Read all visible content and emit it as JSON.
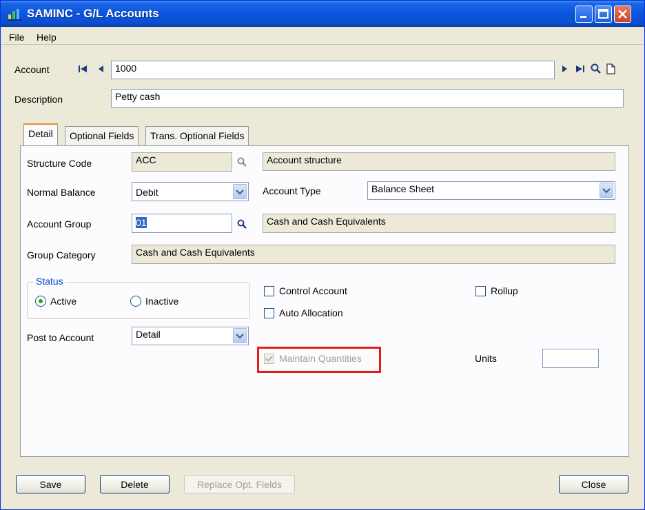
{
  "window": {
    "title": "SAMINC - G/L Accounts"
  },
  "menu": {
    "file": "File",
    "help": "Help"
  },
  "header": {
    "account_label": "Account",
    "account_value": "1000",
    "description_label": "Description",
    "description_value": "Petty cash"
  },
  "tabs": [
    {
      "label": "Detail"
    },
    {
      "label": "Optional Fields"
    },
    {
      "label": "Trans. Optional Fields"
    }
  ],
  "detail": {
    "structure_code_label": "Structure Code",
    "structure_code_value": "ACC",
    "structure_desc": "Account structure",
    "normal_balance_label": "Normal Balance",
    "normal_balance_value": "Debit",
    "account_type_label": "Account Type",
    "account_type_value": "Balance Sheet",
    "account_group_label": "Account Group",
    "account_group_value": "01",
    "account_group_desc": "Cash and Cash Equivalents",
    "group_category_label": "Group Category",
    "group_category_value": "Cash and Cash Equivalents",
    "status_title": "Status",
    "status_active": "Active",
    "status_inactive": "Inactive",
    "control_account": "Control Account",
    "auto_allocation": "Auto Allocation",
    "rollup": "Rollup",
    "post_to_account_label": "Post to Account",
    "post_to_account_value": "Detail",
    "maintain_quantities": "Maintain Quantities",
    "units_label": "Units",
    "units_value": ""
  },
  "buttons": {
    "save": "Save",
    "delete": "Delete",
    "replace": "Replace Opt. Fields",
    "close": "Close"
  },
  "colors": {
    "titlebar": "#0a55dc",
    "highlight": "#e31b1b",
    "tab_accent": "#e68b2c"
  }
}
